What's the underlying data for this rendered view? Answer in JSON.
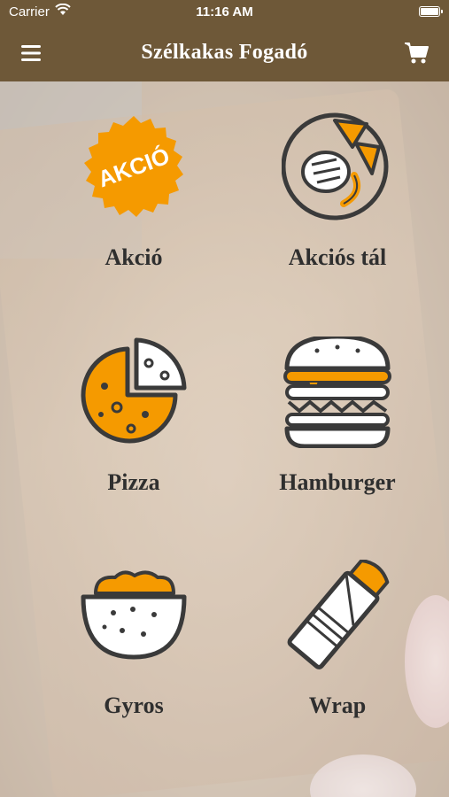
{
  "status_bar": {
    "carrier": "Carrier",
    "time": "11:16 AM"
  },
  "nav": {
    "title": "Szélkakas Fogadó",
    "menu_icon": "hamburger-menu-icon",
    "cart_icon": "shopping-cart-icon"
  },
  "badge_text": "AKCIÓ",
  "colors": {
    "bar": "#6e5838",
    "accent": "#f59a00",
    "line": "#3a3a3a"
  },
  "categories": [
    {
      "label": "Akció",
      "icon": "akcio-badge-icon"
    },
    {
      "label": "Akciós tál",
      "icon": "platter-icon"
    },
    {
      "label": "Pizza",
      "icon": "pizza-icon"
    },
    {
      "label": "Hamburger",
      "icon": "hamburger-icon"
    },
    {
      "label": "Gyros",
      "icon": "gyros-bowl-icon"
    },
    {
      "label": "Wrap",
      "icon": "wrap-icon"
    }
  ]
}
